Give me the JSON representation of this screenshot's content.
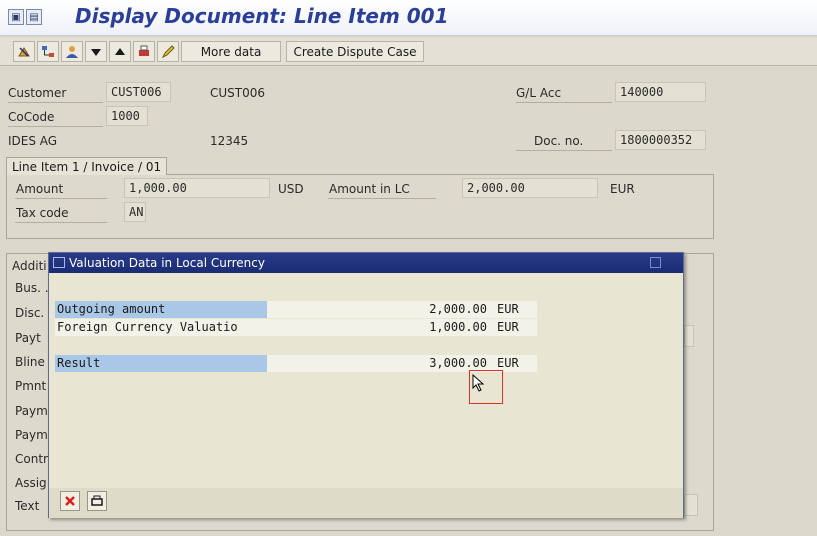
{
  "window": {
    "title": "Display Document: Line Item 001"
  },
  "toolbar": {
    "more_data_label": "More data",
    "create_dispute_label": "Create Dispute Case"
  },
  "header": {
    "customer_label": "Customer",
    "customer_value": "CUST006",
    "customer_name": "CUST006",
    "gl_acc_label": "G/L Acc",
    "gl_acc_value": "140000",
    "cocode_label": "CoCode",
    "cocode_value": "1000",
    "company_name": "IDES AG",
    "company_code_no": "12345",
    "doc_no_label": "Doc. no.",
    "doc_no_value": "1800000352"
  },
  "line_item": {
    "tab_label": "Line Item 1 / Invoice / 01",
    "amount_label": "Amount",
    "amount_value": "1,000.00",
    "amount_currency": "USD",
    "amount_lc_label": "Amount in LC",
    "amount_lc_value": "2,000.00",
    "amount_lc_currency": "EUR",
    "tax_code_label": "Tax code",
    "tax_code_value": "AN"
  },
  "additional": {
    "tab_label_partial": "Additi",
    "labels": [
      "Bus. ...",
      "Disc.",
      "Payt",
      "Bline",
      "Pmnt",
      "Paym",
      "Paym",
      "Contr",
      "Assig",
      "Text"
    ]
  },
  "dialog": {
    "title": "Valuation Data in Local Currency",
    "rows": [
      {
        "label": "Outgoing amount",
        "amount": "2,000.00",
        "currency": "EUR"
      },
      {
        "label": "Foreign Currency Valuatio",
        "amount": "1,000.00",
        "currency": "EUR"
      },
      {
        "label": "Result",
        "amount": "3,000.00",
        "currency": "EUR"
      }
    ]
  },
  "colors": {
    "title_blue": "#2b3f9a",
    "dialog_header": "#1b2c75",
    "row_highlight": "#a9c8e7",
    "cancel_red": "#d92020"
  }
}
